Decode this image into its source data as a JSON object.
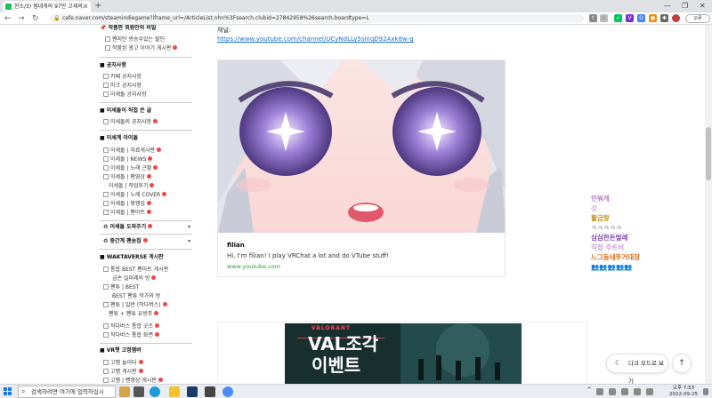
{
  "browser": {
    "tab_title": "한소/3) 썸네게의 97만 고세의...",
    "url": "cafe.naver.com/steamindiegame?iframe_url=/ArticleList.nhn%3Fsearch.clubid=27842958%26search.boardtype=L",
    "profile_label": "오류"
  },
  "sidebar": {
    "top_item": "작품판 회원만의 비밀",
    "group1": [
      "팬지만 방송수있는 할인",
      "작품된 광고 이야기 게시판"
    ],
    "notice_header": "공지사항",
    "notices": [
      "카페 공지사항",
      "미크 공지사항",
      "이세돌 공지사항"
    ],
    "isedol_header": "이세돌이 직접 쓴 글",
    "isedol_items": [
      "이세돌의 공지사항"
    ],
    "fan_header": "이세계 아이돌",
    "fan_items": [
      "이세돌 | 자료게시판",
      "이세돌 | NEWS",
      "이세돌 | 노래 근황",
      "이세돌 | 팬영상",
      "이세돌 | 작업후기",
      "이세돌 | 노래 COVER",
      "이세돌 | 팟캠입",
      "이세돌 | 팬아트"
    ],
    "collapsed1": "이세돌 도와주기",
    "collapsed2": "중간계 팬송집",
    "wak_header": "WAKTAVERSE 게시판",
    "wak_items": [
      "통합 BEST 팬아트 게시판",
      "금손 일러레의 방",
      "팬튜 | BEST",
      "BEST 팬튜 작가의 방",
      "팬튜 | 일반 (작다버스)",
      "팬튜 + 팬튜 유방주",
      "작다버스 통합 굿즈",
      "작다버스 통합 화면"
    ],
    "vr_header": "VR챗 고정멤버",
    "vr_items": [
      "고멤 놀이터",
      "고멤 게시판",
      "고멤 | 팬영상 게시판"
    ]
  },
  "post": {
    "label": "채널:",
    "link": "https://www.youtube.com/channel/UCyNdLLy5sinqD92Axk8w-g",
    "card": {
      "title": "filian",
      "description": "Hi, I'm filian! I play VRChat a lot and do VTube stuff!",
      "domain": "www.youtube.com"
    },
    "banner_title": "VAL조각",
    "banner_subtitle": "이벤트",
    "banner_brand": "VALORANT"
  },
  "chat": [
    {
      "text": "인워게",
      "color": "#b07cc8"
    },
    {
      "text": "갓",
      "color": "#c8a0d8"
    },
    {
      "text": "활금랑",
      "color": "#b88f10"
    },
    {
      "text": "ㅋㅋㅋㅋㅋ",
      "color": "#b0b0b0"
    },
    {
      "text": "심심한돈벌레",
      "color": "#7d3fb0"
    },
    {
      "text": "직접 주트비",
      "color": "#c8a0d8"
    },
    {
      "text": "느그동네뚜거대장",
      "color": "#d2691e"
    }
  ],
  "floating": {
    "darkmode_label": "다크 모드로 보기",
    "top_icon": "arrow-up-icon"
  },
  "taskbar": {
    "search_placeholder": "검색하려면 여기에 입력하십시",
    "time": "오후 7:53",
    "date": "2022-09-25"
  },
  "colors": {
    "naver_green": "#03c75a",
    "link_blue": "#1e6fd0",
    "badge_red": "#f04848",
    "valorant_red": "#ff4655"
  }
}
